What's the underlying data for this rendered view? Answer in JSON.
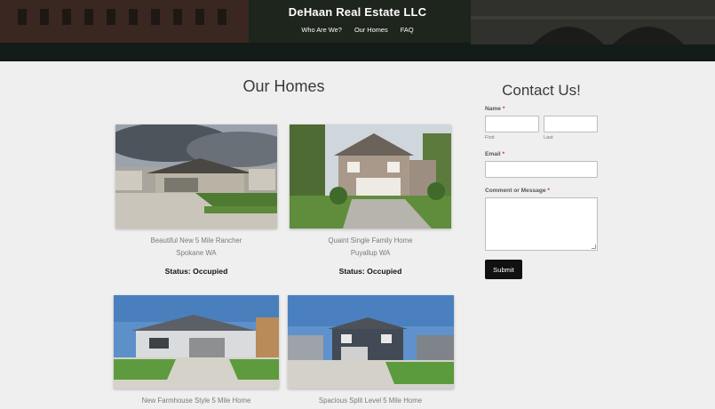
{
  "header": {
    "site_title": "DeHaan Real Estate LLC",
    "nav": [
      "Who Are We?",
      "Our Homes",
      "FAQ"
    ]
  },
  "homes": {
    "section_title": "Our Homes",
    "listings": [
      {
        "title": "Beautiful New 5 Mile Rancher",
        "location": "Spokane WA",
        "status": "Status: Occupied"
      },
      {
        "title": "Quaint Single Family Home",
        "location": "Puyallup WA",
        "status": "Status: Occupied"
      },
      {
        "title": "New Farmhouse Style 5 Mile Home"
      },
      {
        "title": "Spacious Split Level 5 Mile Home"
      }
    ]
  },
  "contact": {
    "title": "Contact Us!",
    "name_label": "Name",
    "required_mark": "*",
    "first_label": "First",
    "last_label": "Last",
    "email_label": "Email",
    "message_label": "Comment or Message",
    "submit_label": "Submit"
  },
  "colors": {
    "accent_required": "#c0392b",
    "button_bg": "#111111",
    "page_bg": "#efefef"
  }
}
